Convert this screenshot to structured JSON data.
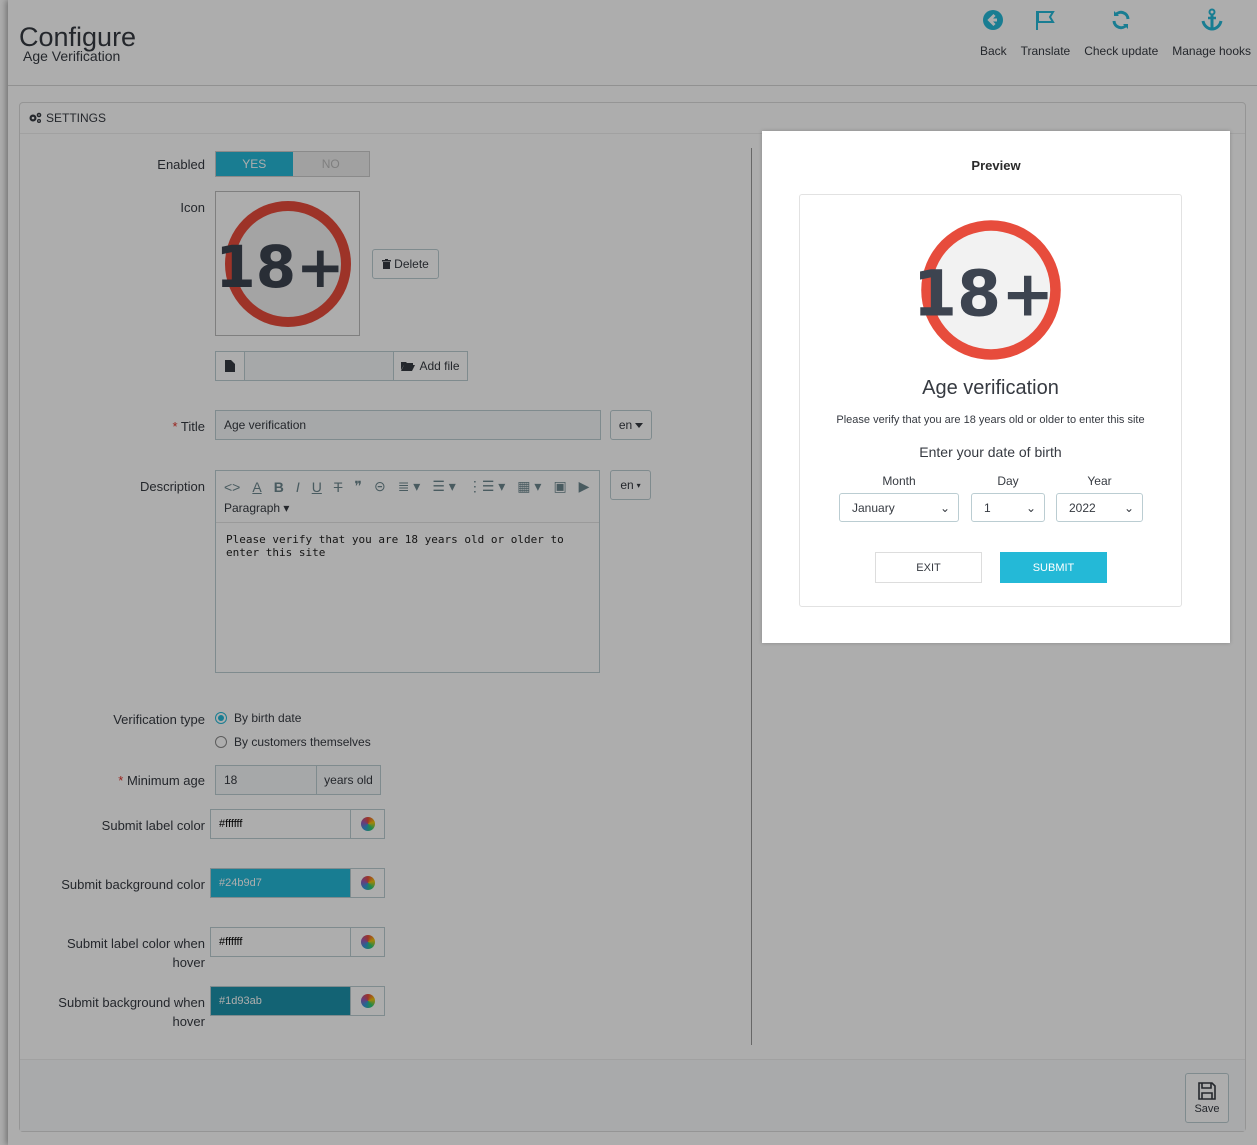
{
  "header": {
    "title": "Configure",
    "subtitle": "Age Verification",
    "toolbar": [
      {
        "label": "Back",
        "icon": "back-icon"
      },
      {
        "label": "Translate",
        "icon": "flag-icon"
      },
      {
        "label": "Check update",
        "icon": "refresh-icon"
      },
      {
        "label": "Manage hooks",
        "icon": "anchor-icon"
      }
    ]
  },
  "panel": {
    "heading": "SETTINGS",
    "heading_icon": "gears-icon"
  },
  "form": {
    "enabled_label": "Enabled",
    "enabled_yes": "YES",
    "enabled_no": "NO",
    "enabled_value": "YES",
    "icon_label": "Icon",
    "badge_text": "18+",
    "delete_label": "Delete",
    "add_file_label": "Add file",
    "title_label": "Title",
    "title_value": "Age verification",
    "lang_code": "en",
    "description_label": "Description",
    "editor_paragraph": "Paragraph",
    "description_value": "Please verify that you are 18 years old or older to enter this site",
    "verification_type_label": "Verification type",
    "verification_options": [
      "By birth date",
      "By customers themselves"
    ],
    "verification_selected": "By birth date",
    "min_age_label": "Minimum age",
    "min_age_value": "18",
    "min_age_suffix": "years old",
    "submit_label_color_label": "Submit label color",
    "submit_label_color": "#ffffff",
    "submit_bg_color_label": "Submit background color",
    "submit_bg_color": "#24b9d7",
    "submit_label_hover_label_1": "Submit label color when",
    "submit_label_hover_label_2": "hover",
    "submit_label_hover_color": "#ffffff",
    "submit_bg_hover_label_1": "Submit background when",
    "submit_bg_hover_label_2": "hover",
    "submit_bg_hover_color": "#1d93ab"
  },
  "preview": {
    "heading": "Preview",
    "title": "Age verification",
    "description": "Please verify that you are 18 years old or older to enter this site",
    "subtitle": "Enter your date of birth",
    "month_label": "Month",
    "day_label": "Day",
    "year_label": "Year",
    "month_value": "January",
    "day_value": "1",
    "year_value": "2022",
    "exit_label": "EXIT",
    "submit_label": "SUBMIT"
  },
  "footer": {
    "save_label": "Save"
  },
  "colors": {
    "accent": "#25b9d7",
    "badge_ring": "#e74c3c",
    "badge_text": "#3d4450"
  }
}
